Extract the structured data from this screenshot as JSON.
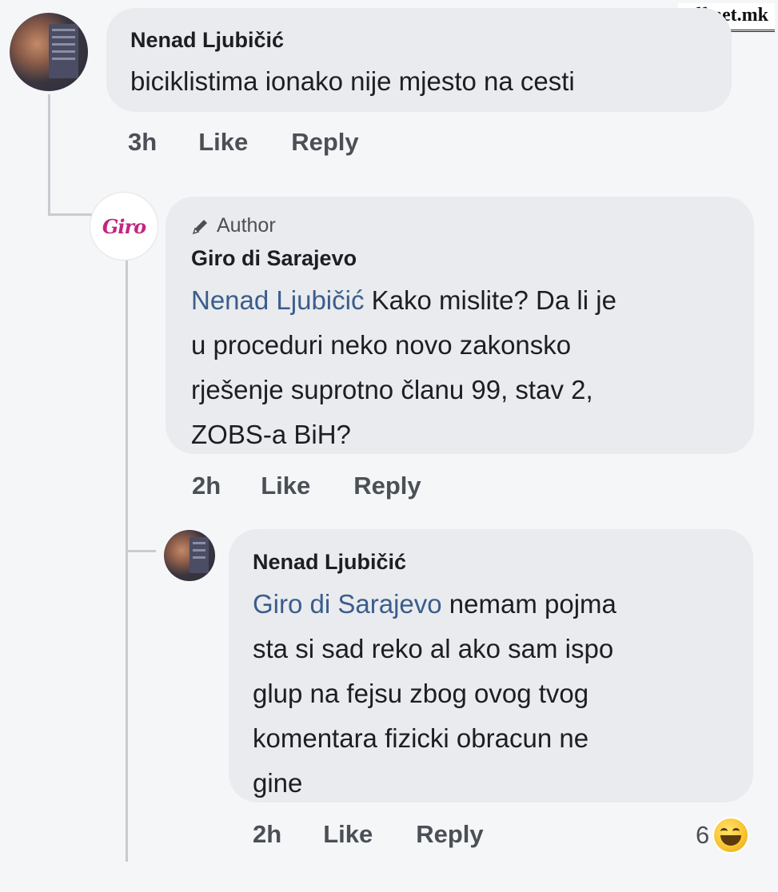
{
  "watermark": "off.net.mk",
  "comments": [
    {
      "author": "Nenad Ljubičić",
      "mention": "",
      "text": "biciklistima ionako nije mjesto na cesti",
      "time": "3h",
      "like": "Like",
      "reply": "Reply"
    },
    {
      "badge": "Author",
      "author": "Giro di Sarajevo",
      "mention": "Nenad Ljubičić",
      "text_lines": [
        " Kako mislite? Da li je",
        "u proceduri neko novo zakonsko",
        "rješenje suprotno članu 99, stav 2,",
        "ZOBS-a BiH?"
      ],
      "time": "2h",
      "like": "Like",
      "reply": "Reply",
      "logo": "Giro"
    },
    {
      "author": "Nenad Ljubičić",
      "mention": "Giro di Sarajevo",
      "text_lines": [
        " nemam pojma",
        "sta si sad reko al ako sam ispo",
        "glup na fejsu zbog ovog tvog",
        "komentara fizicki obracun ne",
        "gine"
      ],
      "time": "2h",
      "like": "Like",
      "reply": "Reply",
      "reaction_count": "6",
      "reaction_icon": "haha-emoji-icon"
    }
  ]
}
